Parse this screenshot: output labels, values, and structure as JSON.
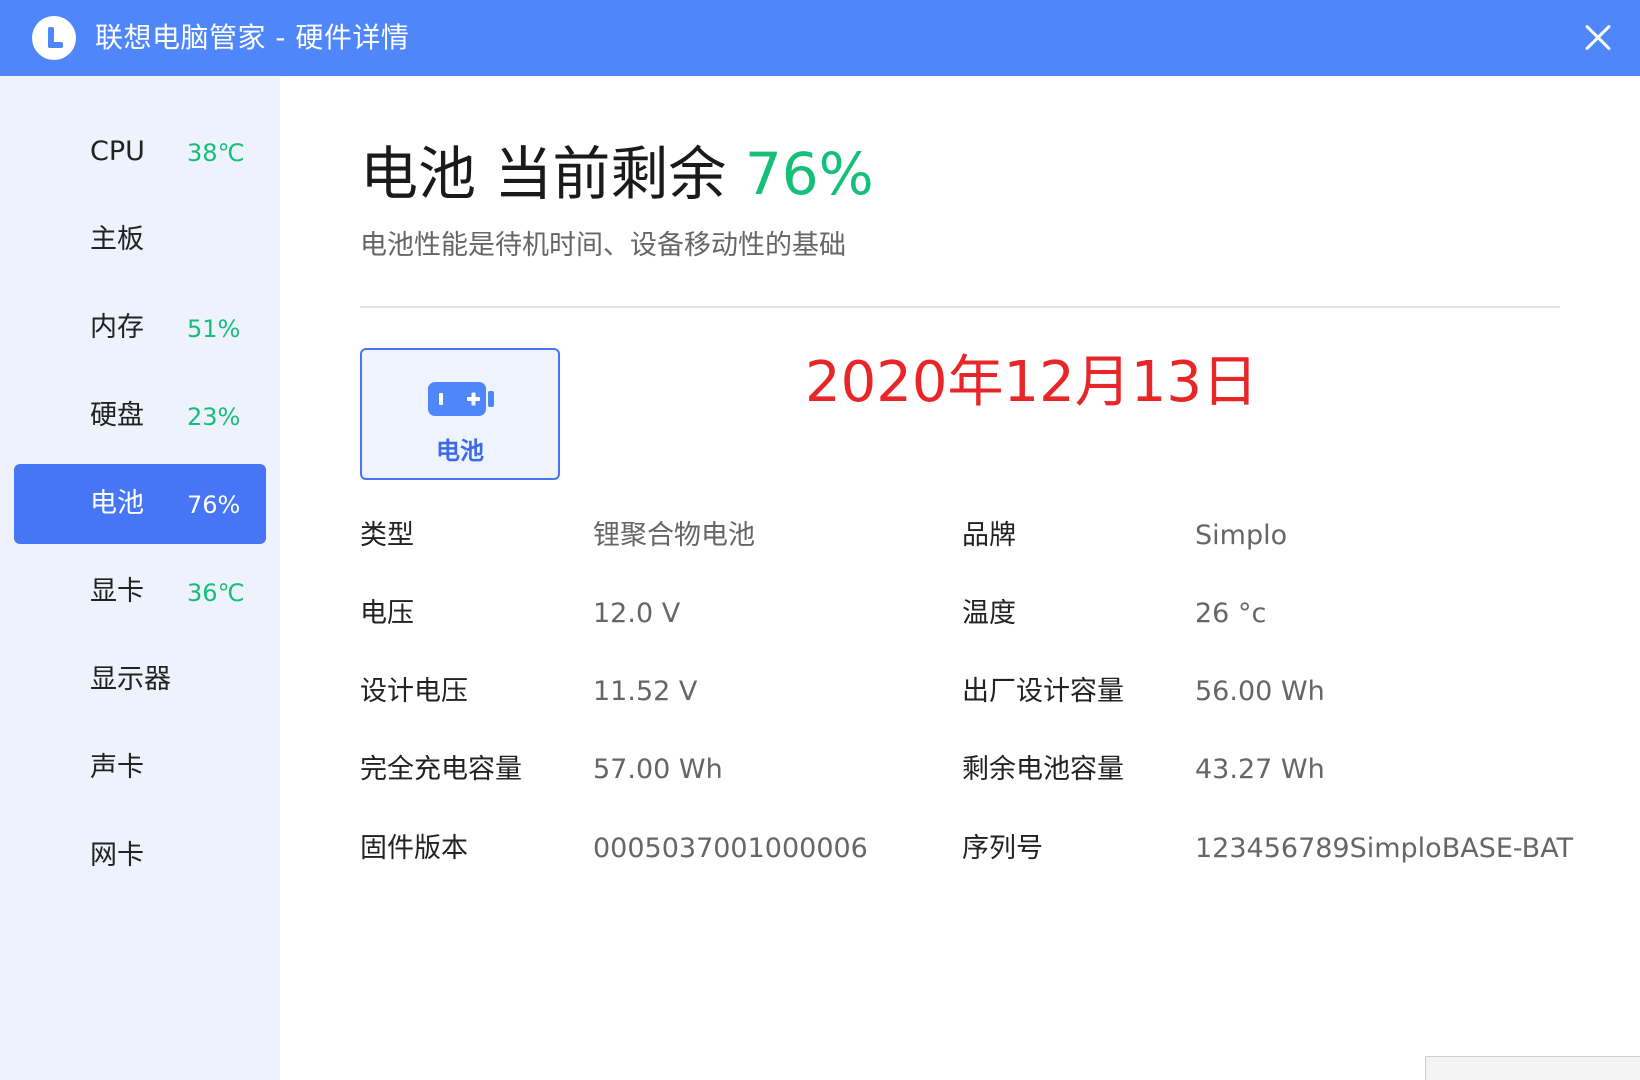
{
  "window": {
    "title": "联想电脑管家 - 硬件详情"
  },
  "sidebar": {
    "items": [
      {
        "label": "CPU",
        "value": "38℃"
      },
      {
        "label": "主板",
        "value": ""
      },
      {
        "label": "内存",
        "value": "51%"
      },
      {
        "label": "硬盘",
        "value": "23%"
      },
      {
        "label": "电池",
        "value": "76%",
        "active": true
      },
      {
        "label": "显卡",
        "value": "36℃"
      },
      {
        "label": "显示器",
        "value": ""
      },
      {
        "label": "声卡",
        "value": ""
      },
      {
        "label": "网卡",
        "value": ""
      }
    ]
  },
  "main": {
    "heading_prefix": "电池 当前剩余",
    "heading_percent": "76%",
    "subtitle": "电池性能是待机时间、设备移动性的基础",
    "device_card_label": "电池",
    "date_stamp": "2020年12月13日",
    "specs": [
      {
        "label": "类型",
        "value": "锂聚合物电池"
      },
      {
        "label": "品牌",
        "value": "Simplo"
      },
      {
        "label": "电压",
        "value": "12.0 V"
      },
      {
        "label": "温度",
        "value": "26 °c"
      },
      {
        "label": "设计电压",
        "value": "11.52 V"
      },
      {
        "label": "出厂设计容量",
        "value": "56.00 Wh"
      },
      {
        "label": "完全充电容量",
        "value": "57.00 Wh"
      },
      {
        "label": "剩余电池容量",
        "value": "43.27 Wh"
      },
      {
        "label": "固件版本",
        "value": "0005037001000006"
      },
      {
        "label": "序列号",
        "value": "123456789SimploBASE-BAT"
      }
    ]
  },
  "colors": {
    "titlebar": "#4f87fb",
    "accent": "#4676f5",
    "good": "#14c078",
    "date": "#e8262a"
  }
}
